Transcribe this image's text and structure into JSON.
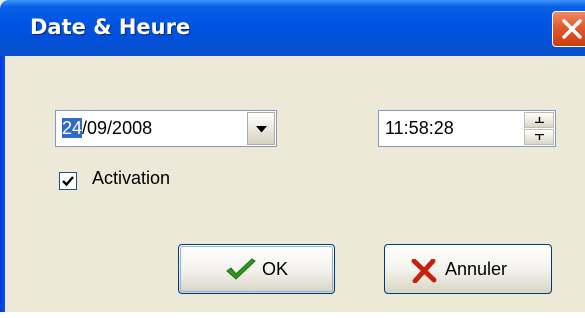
{
  "window": {
    "title": "Date & Heure",
    "close_icon": "close-icon"
  },
  "date": {
    "day": "24",
    "rest": "/09/2008",
    "dropdown_icon": "chevron-down-icon"
  },
  "time": {
    "value": "11:58:28",
    "up_icon": "spin-up-icon",
    "down_icon": "spin-down-icon"
  },
  "activation": {
    "label": "Activation",
    "checked": true
  },
  "buttons": {
    "ok_label": "OK",
    "ok_icon": "checkmark-icon",
    "cancel_label": "Annuler",
    "cancel_icon": "x-mark-icon"
  },
  "colors": {
    "titlebar": "#0054e3",
    "selection": "#316ac5",
    "close": "#e2592f",
    "ok_icon": "#2e9a1e",
    "cancel_icon": "#c8200e"
  }
}
